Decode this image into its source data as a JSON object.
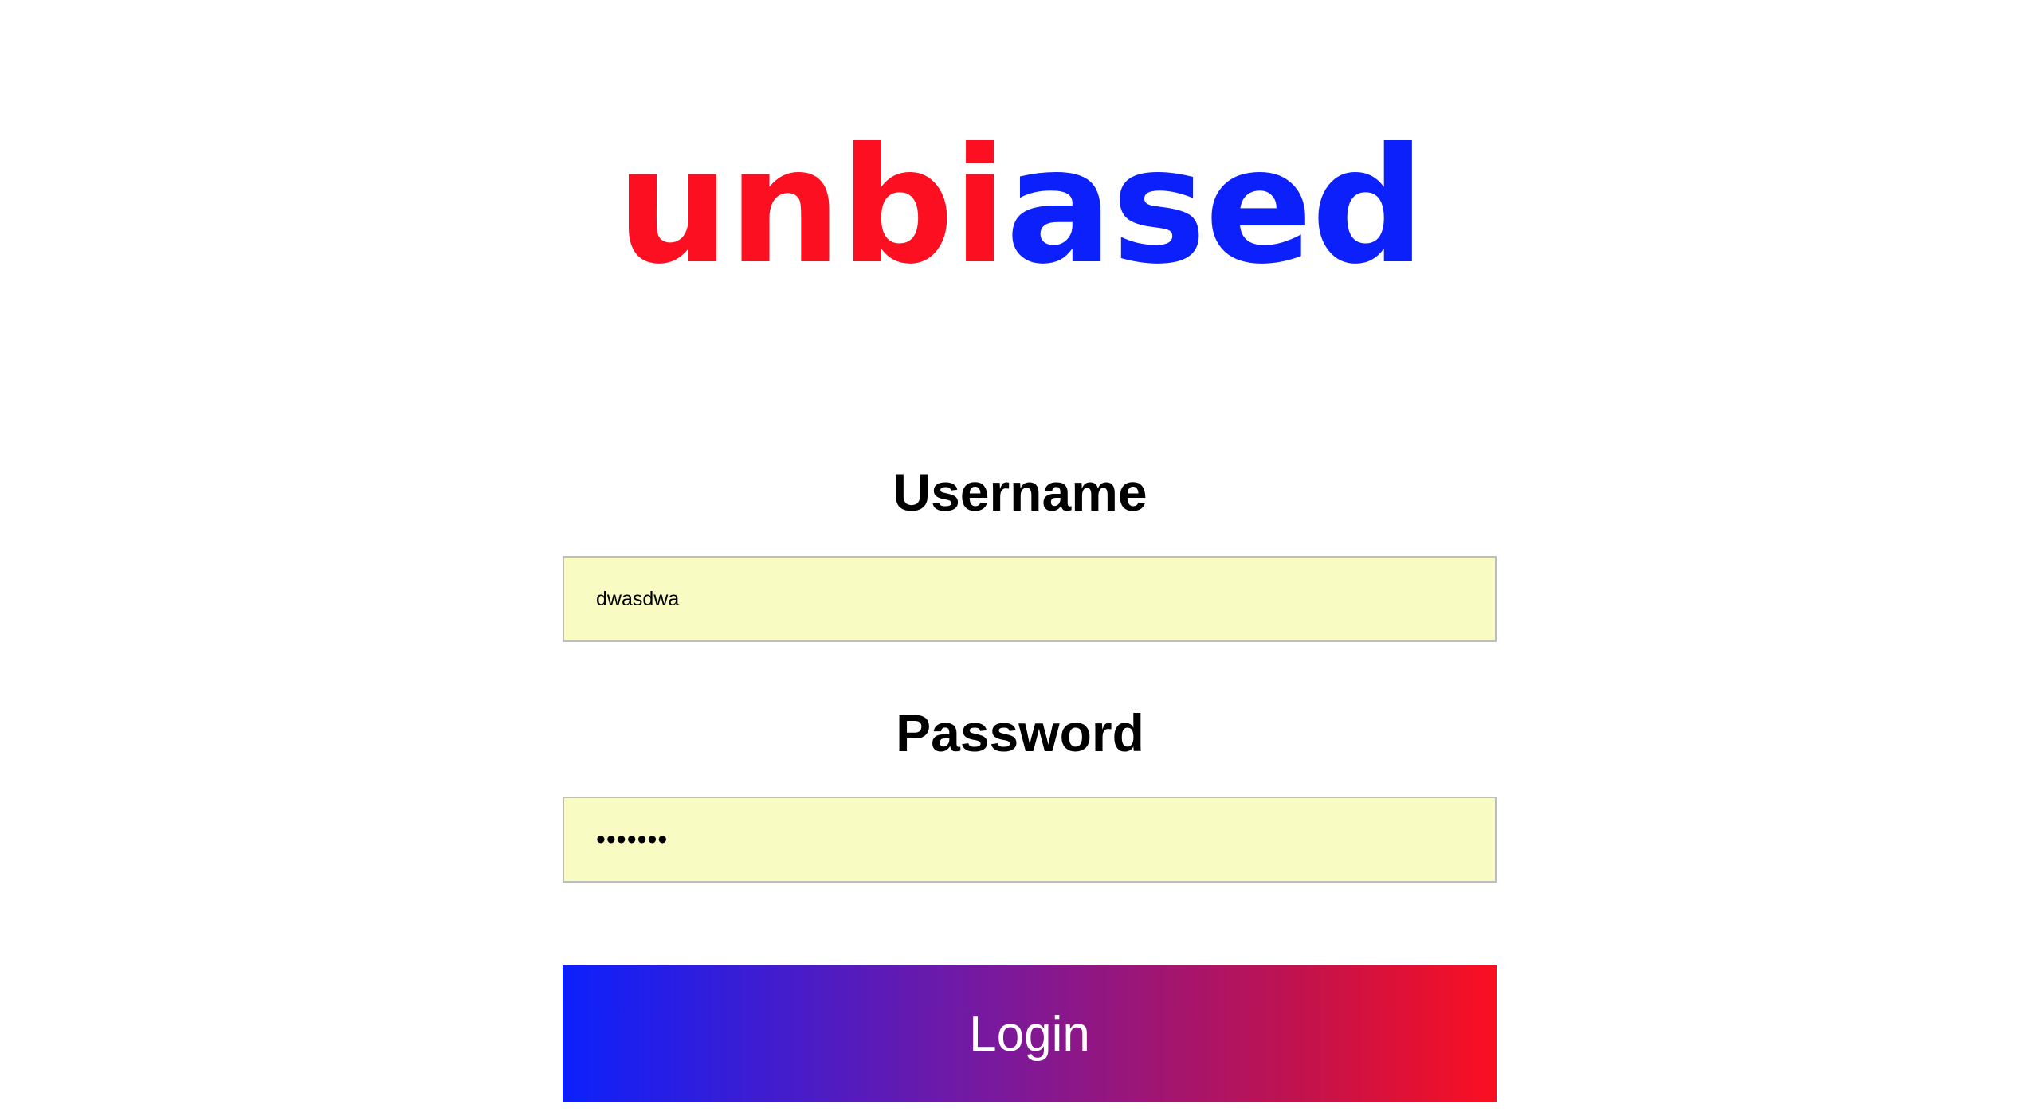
{
  "logo": {
    "part_1": "unbi",
    "part_2": "ased",
    "colors": {
      "red": "#fb0f21",
      "blue": "#0c20fc"
    }
  },
  "form": {
    "username_label": "Username",
    "username_value": "dwasdwa",
    "password_label": "Password",
    "password_value": "dwasdwa",
    "submit_label": "Login",
    "field_background": "#f8fcc3",
    "button_gradient": [
      "#0c20fc",
      "#fb0f21"
    ]
  }
}
